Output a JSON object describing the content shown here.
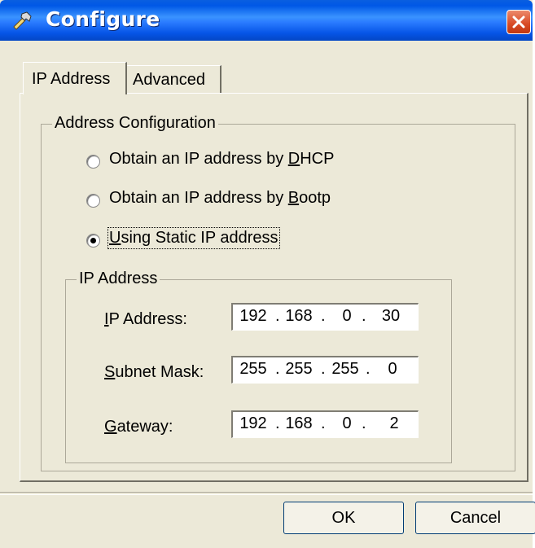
{
  "window": {
    "title": "Configure",
    "title_icon": "wrench-icon",
    "close_icon": "close-icon"
  },
  "tabs": [
    {
      "label": "IP Address",
      "selected": true
    },
    {
      "label": "Advanced",
      "selected": false
    }
  ],
  "address_config": {
    "legend": "Address Configuration",
    "options": [
      {
        "pre": "Obtain an IP address by ",
        "key": "D",
        "post": "HCP",
        "checked": false
      },
      {
        "pre": "Obtain an IP address by ",
        "key": "B",
        "post": "ootp",
        "checked": false
      },
      {
        "pre": "",
        "key": "U",
        "post": "sing Static IP address",
        "checked": true
      }
    ]
  },
  "ip_group": {
    "legend": "IP Address",
    "fields": [
      {
        "key": "I",
        "rest": "P Address:",
        "octets": [
          "192",
          "168",
          "0",
          "30"
        ]
      },
      {
        "key": "S",
        "rest": "ubnet Mask:",
        "octets": [
          "255",
          "255",
          "255",
          "0"
        ]
      },
      {
        "key": "G",
        "rest": "ateway:",
        "octets": [
          "192",
          "168",
          "0",
          "2"
        ]
      }
    ]
  },
  "buttons": {
    "ok": "OK",
    "cancel": "Cancel"
  },
  "colors": {
    "titlebar": "#0058e6",
    "dialog_bg": "#ece9d8",
    "close_button": "#d84a25"
  }
}
